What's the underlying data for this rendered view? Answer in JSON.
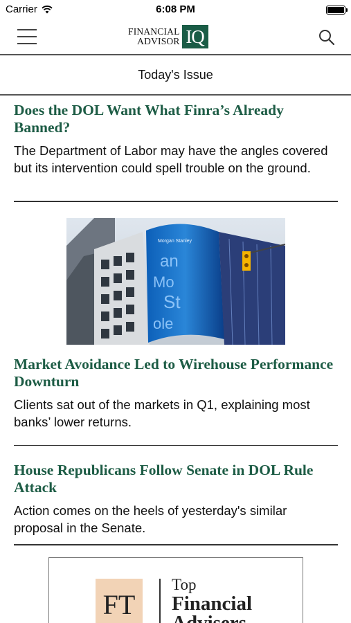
{
  "status_bar": {
    "carrier": "Carrier",
    "time": "6:08 PM",
    "wifi_icon": "wifi-icon",
    "battery_icon": "battery-icon"
  },
  "nav": {
    "menu_icon": "hamburger-menu-icon",
    "logo": {
      "line1": "FINANCIAL",
      "line2": "ADVISOR",
      "mark": "IQ"
    },
    "search_icon": "search-icon"
  },
  "section": {
    "title": "Today's Issue"
  },
  "articles": [
    {
      "headline": "Does the DOL Want What Finra’s Already Banned?",
      "summary": "The Department of Labor may have the angles covered but its intervention could spell trouble on the ground."
    },
    {
      "headline": "Market Avoidance Led to Wirehouse Performance Downturn",
      "summary": "Clients sat out of the markets in Q1, explaining most banks’ lower returns."
    },
    {
      "headline": "House Republicans Follow Senate in DOL Rule Attack",
      "summary": "Action comes on the heels of yesterday's similar proposal in the Senate."
    }
  ],
  "image": {
    "sign_text": "Morgan Stanley"
  },
  "ad": {
    "logo": "FT",
    "line1": "Top",
    "line2": "Financial",
    "line3": "Advisers"
  },
  "colors": {
    "headline": "#1d5c45",
    "logo_mark": "#1a5c46",
    "ft_bg": "#f2d3b6"
  }
}
